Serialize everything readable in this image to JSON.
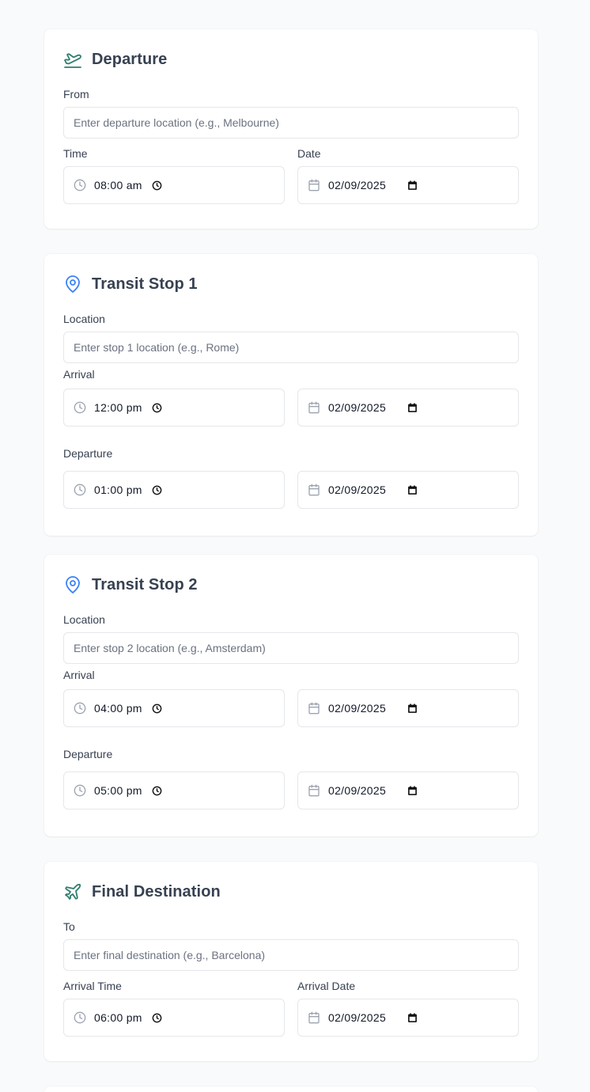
{
  "departure": {
    "title": "Departure",
    "from_label": "From",
    "from_placeholder": "Enter departure location (e.g., Melbourne)",
    "time_label": "Time",
    "date_label": "Date",
    "time": "08:00 am",
    "date": "02/09/2025"
  },
  "stop1": {
    "title": "Transit Stop 1",
    "location_label": "Location",
    "location_placeholder": "Enter stop 1 location (e.g., Rome)",
    "arrival_label": "Arrival",
    "arrival_time": "12:00 pm",
    "arrival_date": "02/09/2025",
    "departure_label": "Departure",
    "departure_time": "01:00 pm",
    "departure_date": "02/09/2025"
  },
  "stop2": {
    "title": "Transit Stop 2",
    "location_label": "Location",
    "location_placeholder": "Enter stop 2 location (e.g., Amsterdam)",
    "arrival_label": "Arrival",
    "arrival_time": "04:00 pm",
    "arrival_date": "02/09/2025",
    "departure_label": "Departure",
    "departure_time": "05:00 pm",
    "departure_date": "02/09/2025"
  },
  "final": {
    "title": "Final Destination",
    "to_label": "To",
    "to_placeholder": "Enter final destination (e.g., Barcelona)",
    "arrival_time_label": "Arrival Time",
    "arrival_date_label": "Arrival Date",
    "arrival_time": "06:00 pm",
    "arrival_date": "02/09/2025"
  },
  "icons": {
    "departure": "plane-departure-icon",
    "transit": "map-pin-icon",
    "final": "plane-icon",
    "time": "clock-icon",
    "date": "calendar-icon",
    "time_picker": "clock-picker-icon",
    "date_picker": "calendar-picker-icon"
  },
  "colors": {
    "accent_green": "#2f7d6d",
    "accent_blue": "#3b82f6",
    "border": "#e5e7eb",
    "background": "#f9fafb"
  }
}
